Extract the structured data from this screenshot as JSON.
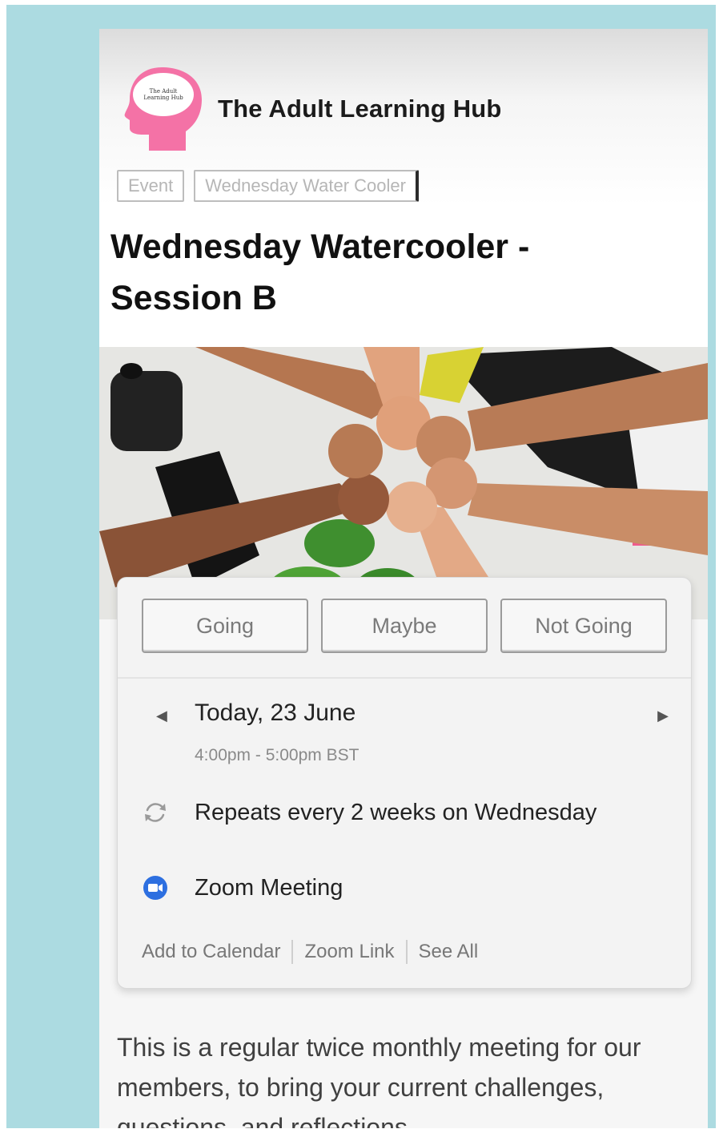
{
  "org": {
    "name": "The Adult Learning Hub",
    "logo_text": "The Adult Learning Hub",
    "logo_color": "#f472a6"
  },
  "tags": [
    "Event",
    "Wednesday Water Cooler"
  ],
  "event": {
    "title": "Wednesday Watercooler - Session B",
    "rsvp": [
      "Going",
      "Maybe",
      "Not Going"
    ],
    "date": "Today, 23 June",
    "time": "4:00pm - 5:00pm BST",
    "repeat": "Repeats every 2 weeks on Wednesday",
    "location": "Zoom Meeting",
    "links": [
      "Add to Calendar",
      "Zoom Link",
      "See All"
    ],
    "description": "This is a regular twice monthly meeting for our members, to bring your current challenges, questions, and reflections"
  },
  "colors": {
    "zoom_blue": "#2d6fe0",
    "background_frame": "#acdbe1"
  }
}
